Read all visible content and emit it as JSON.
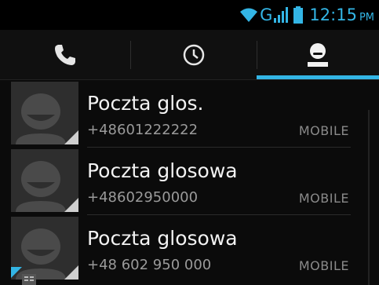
{
  "status_bar": {
    "network_type": "G",
    "time": "12:15",
    "ampm": "PM",
    "accent_color": "#33b5e5",
    "icons": [
      "wifi-icon",
      "signal-icon",
      "battery-icon"
    ]
  },
  "tabs": [
    {
      "name": "phone",
      "icon": "phone-icon",
      "selected": false
    },
    {
      "name": "recent",
      "icon": "clock-icon",
      "selected": false
    },
    {
      "name": "contacts",
      "icon": "person-icon",
      "selected": true
    }
  ],
  "contacts": [
    {
      "name": "Poczta glos.",
      "number": "+48601222222",
      "type": "MOBILE"
    },
    {
      "name": "Poczta glosowa",
      "number": "+48602950000",
      "type": "MOBILE"
    },
    {
      "name": "Poczta glosowa",
      "number": "+48 602 950 000",
      "type": "MOBILE"
    }
  ]
}
